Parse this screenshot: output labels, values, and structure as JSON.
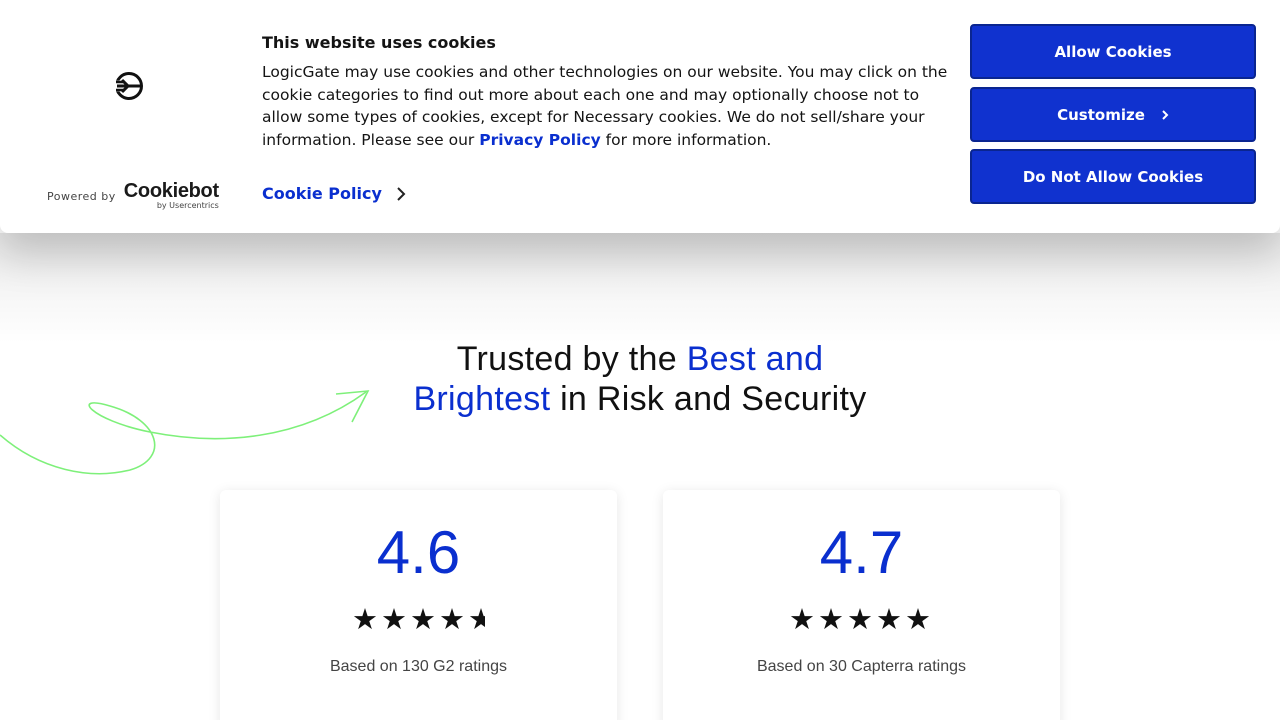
{
  "cookie_banner": {
    "title": "This website uses cookies",
    "body_text": "LogicGate may use cookies and other technologies on our website. You may click on the cookie categories to find out more about each one and may optionally choose not to allow some types of cookies, except for Necessary cookies.  We do not sell/share your information. Please see our ",
    "privacy_link": "Privacy Policy",
    "body_suffix": " for more information.",
    "cookie_policy_link": "Cookie Policy",
    "powered_by": "Powered by",
    "cookiebot_name": "Cookiebot",
    "cookiebot_sub": "by Usercentrics",
    "buttons": {
      "allow": "Allow Cookies",
      "customize": "Customize",
      "deny": "Do Not Allow Cookies"
    },
    "accent_color": "#1032cf"
  },
  "section": {
    "heading_pre": "Trusted by the ",
    "heading_highlight_1": "Best and",
    "heading_highlight_2": "Brightest",
    "heading_post": " in Risk and Security"
  },
  "ratings": [
    {
      "score": "4.6",
      "stars": 4.6,
      "note": "Based on 130 G2 ratings"
    },
    {
      "score": "4.7",
      "stars": 4.7,
      "note": "Based on 30 Capterra ratings"
    }
  ],
  "icons": [
    "logicgate-logo-icon",
    "chevron-right-icon",
    "star-icon",
    "arrow-swoosh-icon"
  ]
}
